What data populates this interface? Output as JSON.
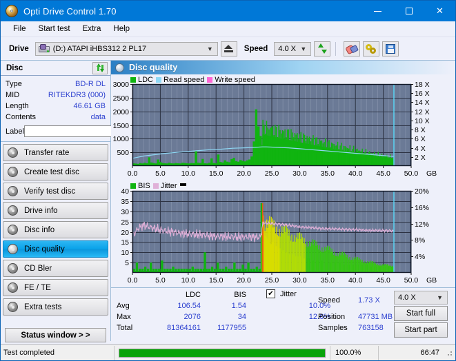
{
  "window": {
    "title": "Opti Drive Control 1.70",
    "icon": "disc-icon",
    "minimize": "─",
    "maximize": "□",
    "close": "✕"
  },
  "menu": {
    "items": [
      "File",
      "Start test",
      "Extra",
      "Help"
    ]
  },
  "toolbar": {
    "drive_label": "Drive",
    "drive_value": "(D:)   ATAPI iHBS312  2 PL17",
    "eject_title": "Eject",
    "speed_label": "Speed",
    "speed_value": "4.0 X",
    "refresh_title": "Refresh",
    "erase_title": "Erase",
    "tools_title": "Tools",
    "save_title": "Save"
  },
  "disc_panel": {
    "header": "Disc",
    "refresh_title": "Refresh disc",
    "rows": [
      {
        "key": "Type",
        "value": "BD-R DL"
      },
      {
        "key": "MID",
        "value": "RITEKDR3 (000)"
      },
      {
        "key": "Length",
        "value": "46.61 GB"
      },
      {
        "key": "Contents",
        "value": "data"
      }
    ],
    "label_key": "Label",
    "label_value": "",
    "label_placeholder": ""
  },
  "sidebar": {
    "items": [
      {
        "label": "Transfer rate",
        "active": false
      },
      {
        "label": "Create test disc",
        "active": false
      },
      {
        "label": "Verify test disc",
        "active": false
      },
      {
        "label": "Drive info",
        "active": false
      },
      {
        "label": "Disc info",
        "active": false
      },
      {
        "label": "Disc quality",
        "active": true
      },
      {
        "label": "CD Bler",
        "active": false
      },
      {
        "label": "FE / TE",
        "active": false
      },
      {
        "label": "Extra tests",
        "active": false
      }
    ],
    "status_window": "Status window > >"
  },
  "main": {
    "header_title": "Disc quality",
    "header_icon": "disc-quality-icon"
  },
  "stats": {
    "col_ldc": "LDC",
    "col_bis": "BIS",
    "rows": [
      {
        "key": "Avg",
        "ldc": "106.54",
        "bis": "1.54",
        "jitter": "10.0%"
      },
      {
        "key": "Max",
        "ldc": "2076",
        "bis": "34",
        "jitter": "12.6%"
      },
      {
        "key": "Total",
        "ldc": "81364161",
        "bis": "1177955",
        "jitter": ""
      }
    ],
    "jitter_label": "Jitter",
    "jitter_checked": true,
    "jitter_check_glyph": "✔",
    "speed_key": "Speed",
    "speed_value": "1.73 X",
    "position_key": "Position",
    "position_value": "47731 MB",
    "samples_key": "Samples",
    "samples_value": "763158",
    "speed_select": "4.0 X",
    "start_full": "Start full",
    "start_part": "Start part"
  },
  "statusbar": {
    "message": "Test completed",
    "percent_label": "100.0%",
    "percent_value": 100,
    "elapsed": "66:47"
  },
  "colors": {
    "ldc_green": "#10b410",
    "bis_green": "#10b410",
    "read_speed": "#8fd8f5",
    "write_speed": "#ff66d4",
    "jitter_pink": "#e0b0d8",
    "plot_bg": "#6b7a96",
    "accent": "#0078d7",
    "value_blue": "#2b3fcf"
  },
  "chart_data": [
    {
      "type": "area",
      "title": "LDC / Read speed",
      "xlabel": "GB",
      "ylabel": "LDC",
      "xlim": [
        0,
        50
      ],
      "ylim": [
        0,
        3000
      ],
      "xticks": [
        "0.0",
        "5.0",
        "10.0",
        "15.0",
        "20.0",
        "25.0",
        "30.0",
        "35.0",
        "40.0",
        "45.0",
        "50.0"
      ],
      "yticks": [
        "500",
        "1000",
        "1500",
        "2000",
        "2500",
        "3000"
      ],
      "y2label": "X",
      "y2lim": [
        0,
        18
      ],
      "y2ticks": [
        "2 X",
        "4 X",
        "6 X",
        "8 X",
        "10 X",
        "12 X",
        "14 X",
        "16 X",
        "18 X"
      ],
      "grid": true,
      "legend": [
        {
          "name": "LDC",
          "color": "#10b410"
        },
        {
          "name": "Read speed",
          "color": "#8fd8f5"
        },
        {
          "name": "Write speed",
          "color": "#ff66d4"
        }
      ],
      "legend_position": "top-left",
      "data_end_gb": 46.9,
      "series": [
        {
          "name": "LDC",
          "type": "bar",
          "color": "#10b410",
          "x": [
            0.2,
            0.6,
            1.0,
            1.4,
            1.8,
            2.2,
            2.6,
            3.0,
            3.4,
            3.8,
            4.2,
            4.6,
            5.0,
            5.4,
            5.8,
            6.2,
            6.6,
            7.0,
            7.4,
            7.8,
            8.2,
            8.6,
            9.0,
            9.4,
            9.8,
            10.2,
            10.6,
            11.0,
            11.4,
            11.8,
            12.2,
            12.6,
            13.0,
            13.4,
            13.8,
            14.2,
            14.6,
            15.0,
            15.4,
            15.8,
            16.2,
            16.6,
            17.0,
            17.4,
            17.8,
            18.2,
            18.6,
            19.0,
            19.4,
            19.8,
            20.2,
            20.6,
            21.0,
            21.4,
            21.8,
            22.2,
            22.6,
            23.0,
            23.3,
            23.6,
            23.9,
            24.2,
            24.6,
            25.0,
            25.4,
            25.8,
            26.2,
            26.6,
            27.0,
            27.4,
            27.8,
            28.2,
            28.6,
            29.0,
            29.4,
            29.8,
            30.4,
            31.0,
            31.6,
            32.2,
            32.8,
            33.4,
            34.0,
            34.6,
            35.2,
            35.8,
            36.4,
            37.0,
            37.6,
            38.2,
            38.8,
            39.4,
            40.0,
            40.6,
            41.2,
            41.8,
            42.4,
            43.0,
            43.6,
            44.2,
            44.8,
            45.4,
            46.0,
            46.6
          ],
          "y": [
            100,
            90,
            80,
            110,
            95,
            120,
            100,
            320,
            130,
            110,
            95,
            240,
            150,
            110,
            100,
            95,
            120,
            100,
            95,
            110,
            100,
            95,
            120,
            110,
            100,
            95,
            110,
            105,
            540,
            120,
            110,
            260,
            100,
            95,
            120,
            280,
            110,
            100,
            420,
            150,
            130,
            210,
            160,
            140,
            250,
            300,
            180,
            160,
            220,
            190,
            170,
            210,
            240,
            350,
            900,
            2076,
            1450,
            1100,
            760,
            820,
            900,
            820,
            760,
            700,
            820,
            760,
            700,
            760,
            680,
            620,
            660,
            600,
            560,
            540,
            520,
            560,
            500,
            540,
            480,
            520,
            460,
            500,
            440,
            480,
            420,
            460,
            400,
            440,
            380,
            420,
            360,
            400,
            340,
            380,
            330,
            360,
            320,
            350,
            310,
            340,
            300,
            330
          ]
        },
        {
          "name": "Read speed",
          "type": "line",
          "color": "#8fd8f5",
          "axis": "right",
          "x": [
            0.0,
            2.0,
            4.0,
            6.0,
            8.0,
            10.0,
            12.0,
            14.0,
            16.0,
            18.0,
            20.0,
            22.0,
            23.3,
            24.0,
            26.0,
            28.0,
            30.0,
            32.0,
            34.0,
            36.0,
            38.0,
            40.0,
            42.0,
            44.0,
            46.0,
            46.9
          ],
          "y": [
            1.7,
            2.2,
            2.5,
            2.8,
            3.0,
            3.2,
            3.4,
            3.6,
            3.7,
            3.9,
            4.0,
            4.1,
            4.2,
            4.2,
            4.1,
            4.0,
            3.8,
            3.6,
            3.4,
            3.2,
            3.0,
            2.8,
            2.6,
            2.4,
            2.2,
            2.1
          ]
        },
        {
          "name": "Write speed",
          "type": "line",
          "color": "#ff66d4",
          "axis": "right",
          "x": [],
          "y": []
        }
      ],
      "markers": [
        {
          "name": "end-cursor",
          "x": 46.9,
          "color": "#55d6f5"
        }
      ]
    },
    {
      "type": "area",
      "title": "BIS / Jitter",
      "xlabel": "GB",
      "ylabel": "BIS",
      "xlim": [
        0,
        50
      ],
      "ylim": [
        0,
        40
      ],
      "xticks": [
        "0.0",
        "5.0",
        "10.0",
        "15.0",
        "20.0",
        "25.0",
        "30.0",
        "35.0",
        "40.0",
        "45.0",
        "50.0"
      ],
      "yticks": [
        "5",
        "10",
        "15",
        "20",
        "25",
        "30",
        "35",
        "40"
      ],
      "y2label": "%",
      "y2lim": [
        0,
        20
      ],
      "y2ticks": [
        "4%",
        "8%",
        "12%",
        "16%",
        "20%"
      ],
      "grid": true,
      "legend": [
        {
          "name": "BIS",
          "color": "#10b410"
        },
        {
          "name": "Jitter",
          "color": "#e0b0d8"
        },
        {
          "name": "avg-marker",
          "color": "#000000"
        }
      ],
      "legend_position": "top-left",
      "data_end_gb": 46.9,
      "series": [
        {
          "name": "BIS",
          "type": "bar",
          "color": "#10b410",
          "x": [
            0.3,
            0.8,
            1.3,
            1.8,
            2.3,
            2.8,
            3.3,
            3.8,
            4.3,
            4.8,
            5.3,
            5.8,
            6.3,
            6.8,
            7.3,
            7.8,
            8.3,
            8.8,
            9.3,
            9.8,
            10.3,
            10.8,
            11.3,
            11.8,
            12.3,
            12.8,
            13.0,
            13.3,
            13.8,
            14.3,
            14.8,
            15.3,
            15.8,
            16.3,
            16.8,
            17.3,
            17.8,
            18.3,
            18.8,
            19.3,
            19.8,
            20.3,
            20.8,
            21.3,
            21.8,
            22.3,
            22.8,
            23.2,
            23.4,
            23.7,
            24.0,
            24.4,
            24.8,
            25.2,
            25.8,
            26.4,
            27.0,
            27.6,
            28.2,
            28.8,
            29.4,
            30.0,
            30.8,
            31.6,
            32.4,
            33.2,
            34.0,
            34.8,
            35.6,
            36.4,
            37.2,
            38.0,
            38.8,
            39.6,
            40.4,
            41.2,
            42.0,
            42.8,
            43.6,
            44.4,
            45.2,
            46.0,
            46.6
          ],
          "y": [
            2,
            5,
            2,
            2,
            3,
            2,
            5,
            2,
            2,
            2,
            6,
            2,
            2,
            2,
            3,
            2,
            2,
            2,
            2,
            2,
            2,
            3,
            2,
            2,
            2,
            2,
            10,
            2,
            2,
            3,
            2,
            5,
            2,
            2,
            3,
            2,
            2,
            5,
            2,
            2,
            4,
            2,
            5,
            2,
            2,
            3,
            2,
            34,
            22,
            18,
            17,
            16,
            14,
            15,
            13,
            12,
            11,
            10,
            9,
            9,
            8,
            8,
            7,
            7,
            6,
            6,
            6,
            5,
            5,
            5,
            5,
            4,
            4,
            4,
            4,
            4,
            4,
            3,
            3,
            3,
            3,
            3,
            3
          ]
        },
        {
          "name": "Jitter",
          "type": "line",
          "color": "#e0b0d8",
          "axis": "right",
          "x": [
            0.2,
            1.0,
            2.0,
            3.0,
            4.0,
            5.0,
            6.0,
            7.0,
            8.0,
            9.0,
            10.0,
            11.0,
            12.0,
            13.0,
            14.0,
            15.0,
            16.0,
            17.0,
            18.0,
            19.0,
            20.0,
            21.0,
            22.0,
            23.0,
            23.4,
            24.0,
            25.0,
            26.0,
            27.0,
            28.0,
            29.0,
            30.0,
            32.0,
            34.0,
            36.0,
            38.0,
            40.0,
            42.0,
            44.0,
            46.0,
            46.9
          ],
          "y": [
            9.3,
            10.8,
            11.6,
            11.2,
            10.8,
            10.5,
            10.2,
            10.0,
            9.8,
            9.6,
            9.5,
            9.4,
            9.3,
            9.2,
            9.0,
            8.9,
            8.9,
            8.8,
            8.8,
            8.7,
            8.8,
            8.8,
            8.7,
            8.7,
            12.2,
            12.1,
            12.0,
            11.9,
            11.8,
            11.6,
            11.4,
            11.2,
            11.0,
            10.8,
            10.7,
            10.6,
            10.5,
            10.4,
            10.3,
            10.3,
            10.2
          ]
        }
      ],
      "markers": [
        {
          "name": "end-cursor",
          "x": 46.9,
          "color": "#55d6f5"
        }
      ]
    }
  ]
}
